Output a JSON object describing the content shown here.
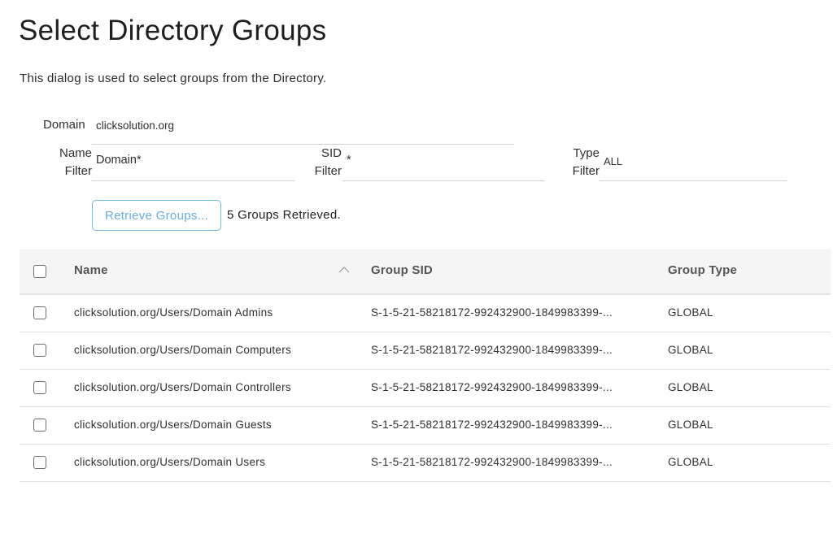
{
  "page": {
    "title": "Select Directory Groups",
    "description": "This dialog is used to select groups from the Directory."
  },
  "form": {
    "domain_label": "Domain",
    "domain_value": "clicksolution.org",
    "name_filter_label_1": "Name",
    "name_filter_label_2": "Filter",
    "name_filter_value": "Domain*",
    "sid_filter_label_1": "SID",
    "sid_filter_label_2": "Filter",
    "sid_filter_value": "*",
    "type_filter_label_1": "Type",
    "type_filter_label_2": "Filter",
    "type_filter_value": "ALL",
    "retrieve_button_label": "Retrieve Groups...",
    "status_text": "5 Groups Retrieved."
  },
  "table": {
    "columns": [
      {
        "label": "Name",
        "sorted": "ascending",
        "sort_icon": "chevron-up-icon"
      },
      {
        "label": "Group SID"
      },
      {
        "label": "Group Type"
      }
    ],
    "rows": [
      {
        "name": "clicksolution.org/Users/Domain Admins",
        "sid": "S-1-5-21-58218172-992432900-1849983399-...",
        "type": "GLOBAL",
        "checked": false
      },
      {
        "name": "clicksolution.org/Users/Domain Computers",
        "sid": "S-1-5-21-58218172-992432900-1849983399-...",
        "type": "GLOBAL",
        "checked": false
      },
      {
        "name": "clicksolution.org/Users/Domain Controllers",
        "sid": "S-1-5-21-58218172-992432900-1849983399-...",
        "type": "GLOBAL",
        "checked": false
      },
      {
        "name": "clicksolution.org/Users/Domain Guests",
        "sid": "S-1-5-21-58218172-992432900-1849983399-...",
        "type": "GLOBAL",
        "checked": false
      },
      {
        "name": "clicksolution.org/Users/Domain Users",
        "sid": "S-1-5-21-58218172-992432900-1849983399-...",
        "type": "GLOBAL",
        "checked": false
      }
    ]
  },
  "colors": {
    "accent": "#6aaee0",
    "header_bg": "#f5f5f5",
    "border": "#e3e3e3"
  }
}
